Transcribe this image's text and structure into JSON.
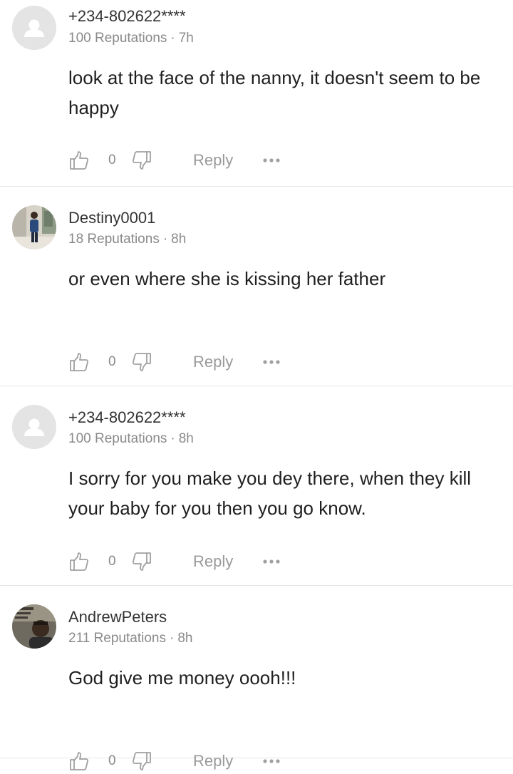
{
  "comments": [
    {
      "username": "+234-802622****",
      "reputation": "100 Reputations",
      "time": "7h",
      "text": "look at the face of the nanny, it doesn't seem to be happy",
      "likes": "0",
      "reply_label": "Reply",
      "avatar": "default-avatar-icon"
    },
    {
      "username": "Destiny0001",
      "reputation": "18 Reputations",
      "time": "8h",
      "text": "or even where she is kissing her father",
      "likes": "0",
      "reply_label": "Reply",
      "avatar": "user-photo"
    },
    {
      "username": "+234-802622****",
      "reputation": "100 Reputations",
      "time": "8h",
      "text": "I sorry for you make you dey there, when they kill your baby for you then you go know.",
      "likes": "0",
      "reply_label": "Reply",
      "avatar": "default-avatar-icon"
    },
    {
      "username": "AndrewPeters",
      "reputation": "211 Reputations",
      "time": "8h",
      "text": "God give me money oooh!!!",
      "likes": "0",
      "reply_label": "Reply",
      "avatar": "user-photo"
    }
  ],
  "meta_separator": "·",
  "colors": {
    "username": "#333333",
    "meta": "#8a8a8a",
    "icon": "#a0a0a0",
    "divider": "#e6e6e6"
  }
}
